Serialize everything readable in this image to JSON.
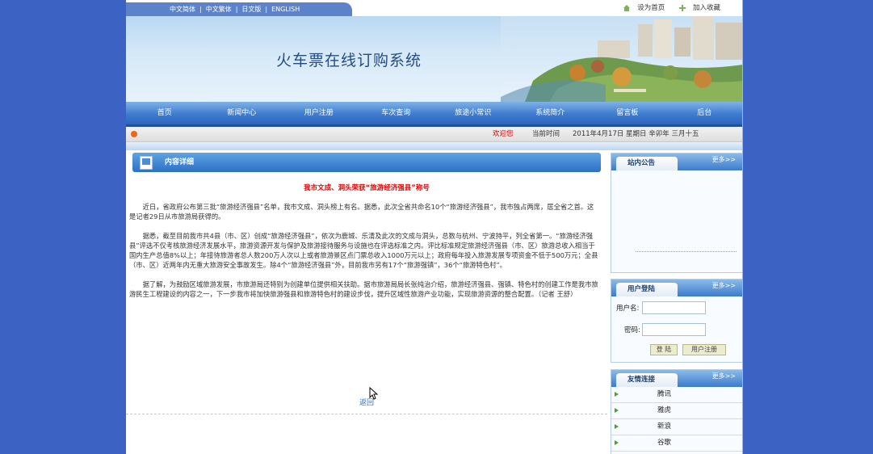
{
  "languages": [
    "中文简体",
    "中文繁体",
    "日文版",
    "ENGLISH"
  ],
  "top_links": {
    "homepage": "设为首页",
    "favorite": "加入收藏"
  },
  "site_title": "火车票在线订购系统",
  "nav": [
    "首页",
    "新闻中心",
    "用户注册",
    "车次查询",
    "旅途小常识",
    "系统简介",
    "留言板",
    "后台"
  ],
  "status": {
    "welcome": "欢迎您",
    "time_label": "当前时间",
    "time_value": "2011年4月17日 星期日 辛卯年 三月十五"
  },
  "content": {
    "header": "内容详细",
    "article_title": "我市文成、洞头荣获“旅游经济强县”称号",
    "paragraphs": [
      "近日，省政府公布第三批“旅游经济强县”名单，我市文成、洞头榜上有名。据悉，此次全省共命名10个“旅游经济强县”，我市独占两席，居全省之首。这是记者29日从市旅游局获得的。",
      "据悉，截至目前我市共4县（市、区）创成“旅游经济强县”，依次为鹿城、乐清及此次的文成与洞头，总数与杭州、宁波持平，列全省第一。“旅游经济强县”评选不仅考核旅游经济发展水平，旅游资源开发与保护及旅游接待服务与设施也在评选标准之内。评比标准规定旅游经济强县（市、区）旅游总收入相当于国内生产总值8%以上；年接待旅游者总人数200万人次以上或者旅游景区点门票总收入1000万元以上；政府每年投入旅游发展专项资金不低于500万元；全县（市、区）近两年内无重大旅游安全事故发生。除4个“旅游经济强县”外，目前我市另有17个“旅游强镇”，36个“旅游特色村”。",
      "据了解，为鼓励区域旅游发展，市旅游局还特别为创建单位提供相关扶助。据市旅游局局长张纯治介绍，旅游经济强县、强镇、特色村的创建工作是我市旅游民生工程建设的内容之一，下一步我市将加快旅游强县和旅游特色村的建设步伐，提升区域性旅游产业功能，实现旅游资源的整合配置。（记者 王舒）"
    ],
    "back": "返回"
  },
  "sidebar": {
    "more": "更多>>",
    "notice_title": "站内公告",
    "login_title": "用户登陆",
    "username_label": "用户名:",
    "password_label": "密码:",
    "login_btn": "登 陆",
    "register_btn": "用户注册",
    "links_title": "友情连接",
    "links": [
      "腾讯",
      "雅虎",
      "新浪",
      "谷歌"
    ]
  },
  "colors": {
    "page_bg": "#3c62c4",
    "nav": "#3f7bd0",
    "accent_red": "#e00000",
    "link_arrow": "#4ca52a"
  }
}
